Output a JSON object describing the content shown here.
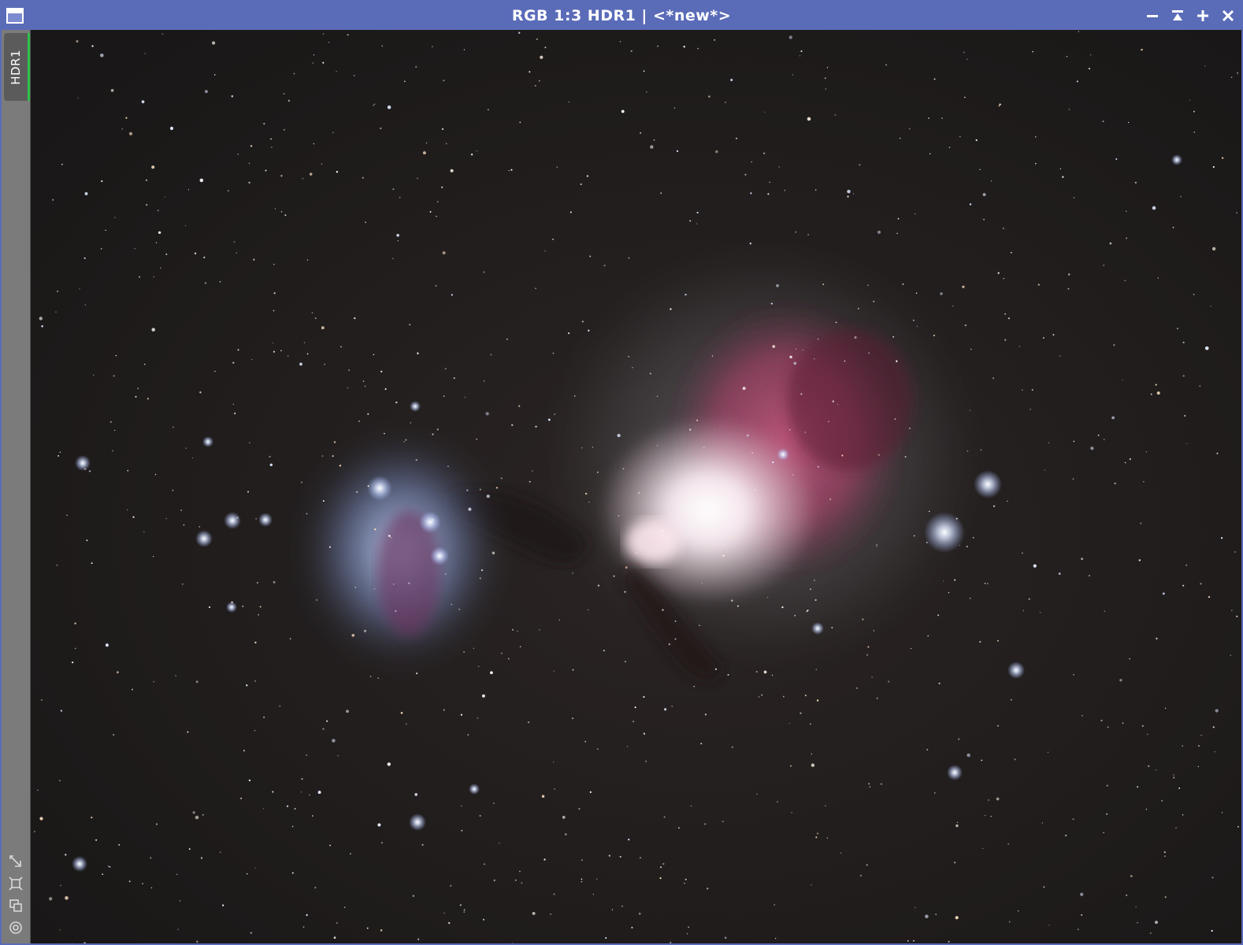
{
  "window": {
    "title": "RGB 1:3 HDR1 | <*new*>",
    "accent_color": "#5a6bb8",
    "controls": [
      {
        "name": "shade-button",
        "icon": "minus-icon",
        "glyph": "‒"
      },
      {
        "name": "maximize-top-button",
        "icon": "collapse-up-icon",
        "glyph": "⍒"
      },
      {
        "name": "maximize-button",
        "icon": "plus-icon",
        "glyph": "+"
      },
      {
        "name": "close-button",
        "icon": "close-icon",
        "glyph": "✕"
      }
    ]
  },
  "sidebar": {
    "view_tab_label": "HDR1",
    "active_tab_color": "#2ec24a",
    "tools": [
      {
        "name": "readout-tool",
        "icon": "arrow-diagonal-icon"
      },
      {
        "name": "zoom-fit-tool",
        "icon": "frame-icon"
      },
      {
        "name": "preview-tool",
        "icon": "windows-icon"
      },
      {
        "name": "target-tool",
        "icon": "target-icon"
      }
    ]
  },
  "image": {
    "subject": "Orion Nebula astrophotograph",
    "background_color": "#1c1a19",
    "nebula_colors": [
      "#ffffff",
      "#d9607f",
      "#9db2e8"
    ]
  }
}
